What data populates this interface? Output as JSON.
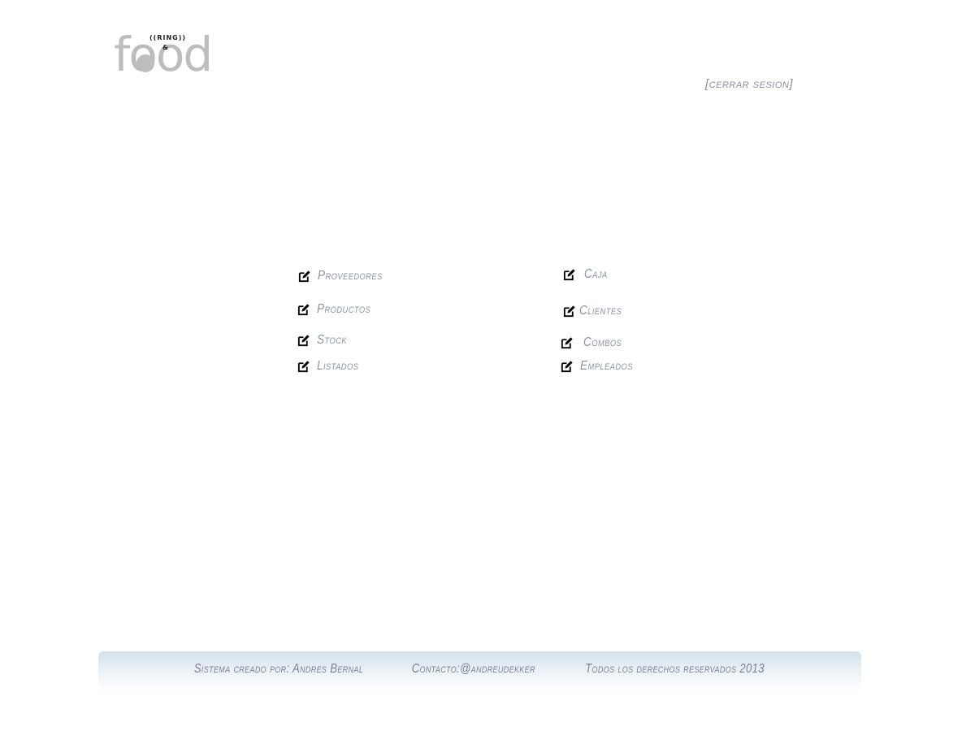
{
  "logo": {
    "word": "food",
    "ring_text": "((RING))",
    "amp_text": "&"
  },
  "header": {
    "logout_label": "[cerrar sesion]"
  },
  "menu": {
    "left": [
      {
        "label": "Proveedores",
        "icon": "edit-icon"
      },
      {
        "label": "Productos",
        "icon": "edit-icon"
      },
      {
        "label": "Stock",
        "icon": "edit-icon"
      },
      {
        "label": "Listados",
        "icon": "edit-icon"
      }
    ],
    "right": [
      {
        "label": "Caja",
        "icon": "edit-icon"
      },
      {
        "label": "Clientes",
        "icon": "edit-icon"
      },
      {
        "label": "Combos",
        "icon": "edit-icon"
      },
      {
        "label": "Empleados",
        "icon": "edit-icon"
      }
    ]
  },
  "footer": {
    "credit": "Sistema creado por: Andres Bernal",
    "contact": "Contacto:@andreudekker",
    "rights": "Todos los derechos reservados  2013"
  },
  "colors": {
    "text_gray": "#8d92a0",
    "logo_gray": "#bdbdbd",
    "footer_gradient_top": "#d3e0ea"
  }
}
